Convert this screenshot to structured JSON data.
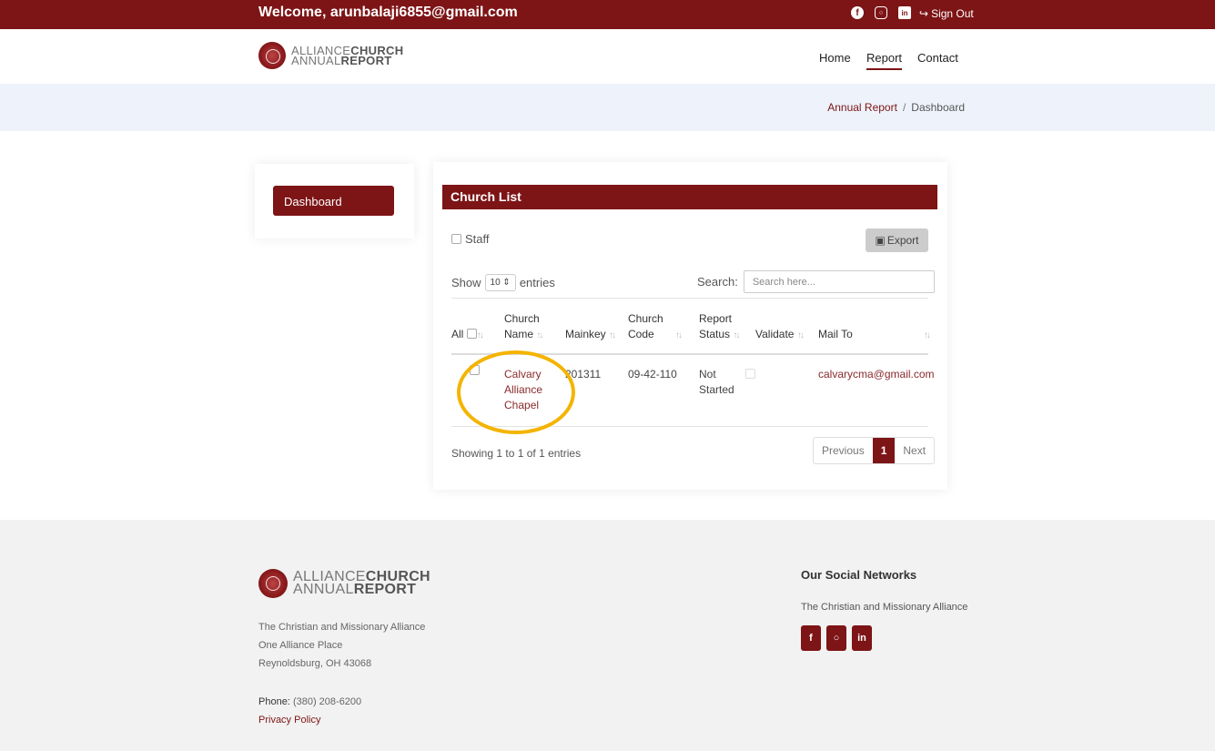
{
  "topbar": {
    "welcome": "Welcome, arunbalaji6855@gmail.com",
    "signout": "Sign Out",
    "icons": [
      "facebook-icon",
      "instagram-icon",
      "linkedin-icon"
    ]
  },
  "logo": {
    "line1_a": "ALLIANCE",
    "line1_b": "CHURCH",
    "line2_a": "ANNUAL",
    "line2_b": "REPORT"
  },
  "nav": {
    "home": "Home",
    "report": "Report",
    "contact": "Contact",
    "active": "Report"
  },
  "breadcrumb": {
    "parent": "Annual Report",
    "separator": "/",
    "current": "Dashboard"
  },
  "sidebar": {
    "dashboard": "Dashboard"
  },
  "card": {
    "title": "Church List",
    "staff_label": "Staff",
    "export_label": "Export",
    "show_label": "Show",
    "entries_value": "10",
    "entries_label": "entries",
    "search_label": "Search:",
    "search_placeholder": "Search here..."
  },
  "table": {
    "columns": {
      "all": "All",
      "church_name_1": "Church",
      "church_name_2": "Name",
      "mainkey": "Mainkey",
      "church_code_1": "Church",
      "church_code_2": "Code",
      "report_status_1": "Report",
      "report_status_2": "Status",
      "validate": "Validate",
      "mail_to": "Mail To"
    },
    "rows": [
      {
        "name_1": "Calvary",
        "name_2": "Alliance",
        "name_3": "Chapel",
        "mainkey": "201311",
        "code": "09-42-110",
        "status_1": "Not",
        "status_2": "Started",
        "mail": "calvarycma@gmail.com"
      }
    ],
    "showing": "Showing 1 to 1 of 1 entries",
    "pager": {
      "prev": "Previous",
      "page": "1",
      "next": "Next"
    }
  },
  "footer": {
    "org": "The Christian and Missionary Alliance",
    "address1": "One Alliance Place",
    "address2": "Reynoldsburg, OH 43068",
    "phone_label": "Phone:",
    "phone": "(380) 208-6200",
    "privacy": "Privacy Policy",
    "social_title": "Our Social Networks",
    "social_sub": "The Christian and Missionary Alliance"
  },
  "colors": {
    "brand": "#7d1416",
    "band": "#eef3fb",
    "footer": "#f2f2f2",
    "highlight": "#f4b400"
  }
}
